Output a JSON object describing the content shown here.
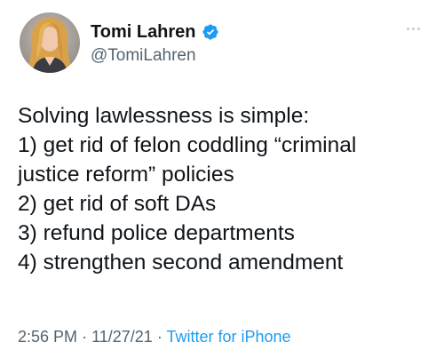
{
  "author": {
    "display_name": "Tomi Lahren",
    "handle": "@TomiLahren",
    "verified": true,
    "avatar_icon": "profile-photo"
  },
  "tweet": {
    "lines": [
      "Solving lawlessness is simple:",
      "1) get rid of felon coddling “criminal",
      "justice reform” policies",
      "2) get rid of soft DAs",
      "3) refund police departments",
      "4) strengthen second amendment"
    ]
  },
  "meta": {
    "time": "2:56 PM",
    "separator": "·",
    "date": "11/27/21",
    "source": "Twitter for iPhone"
  },
  "colors": {
    "text": "#0f1419",
    "secondary": "#536471",
    "accent": "#1d9bf0"
  },
  "icons": {
    "verified": "verified-badge-icon",
    "more": "more-options-icon"
  }
}
